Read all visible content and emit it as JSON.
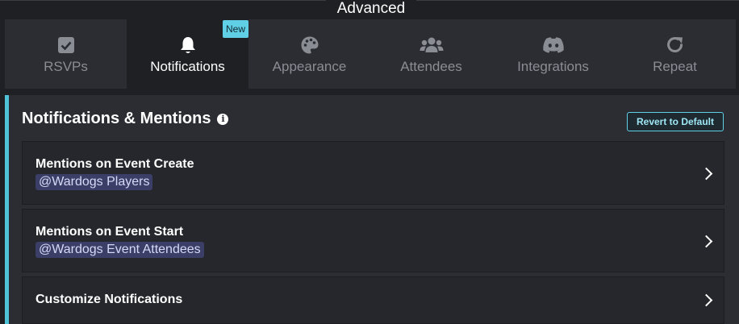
{
  "header": {
    "title": "Advanced"
  },
  "tabs": [
    {
      "label": "RSVPs",
      "icon": "check-square-icon"
    },
    {
      "label": "Notifications",
      "icon": "bell-icon",
      "active": true,
      "badge": "New"
    },
    {
      "label": "Appearance",
      "icon": "palette-icon"
    },
    {
      "label": "Attendees",
      "icon": "users-icon"
    },
    {
      "label": "Integrations",
      "icon": "discord-icon"
    },
    {
      "label": "Repeat",
      "icon": "repeat-icon"
    }
  ],
  "section": {
    "title": "Notifications & Mentions",
    "info_icon": "info-icon",
    "revert_label": "Revert to Default",
    "rows": [
      {
        "title": "Mentions on Event Create",
        "mention": "@Wardogs Players"
      },
      {
        "title": "Mentions on Event Start",
        "mention": "@Wardogs Event Attendees"
      },
      {
        "title": "Customize Notifications"
      }
    ]
  },
  "colors": {
    "accent": "#4fc3d8",
    "badge": "#5fd0e6",
    "mention_bg": "#3b3f68"
  }
}
